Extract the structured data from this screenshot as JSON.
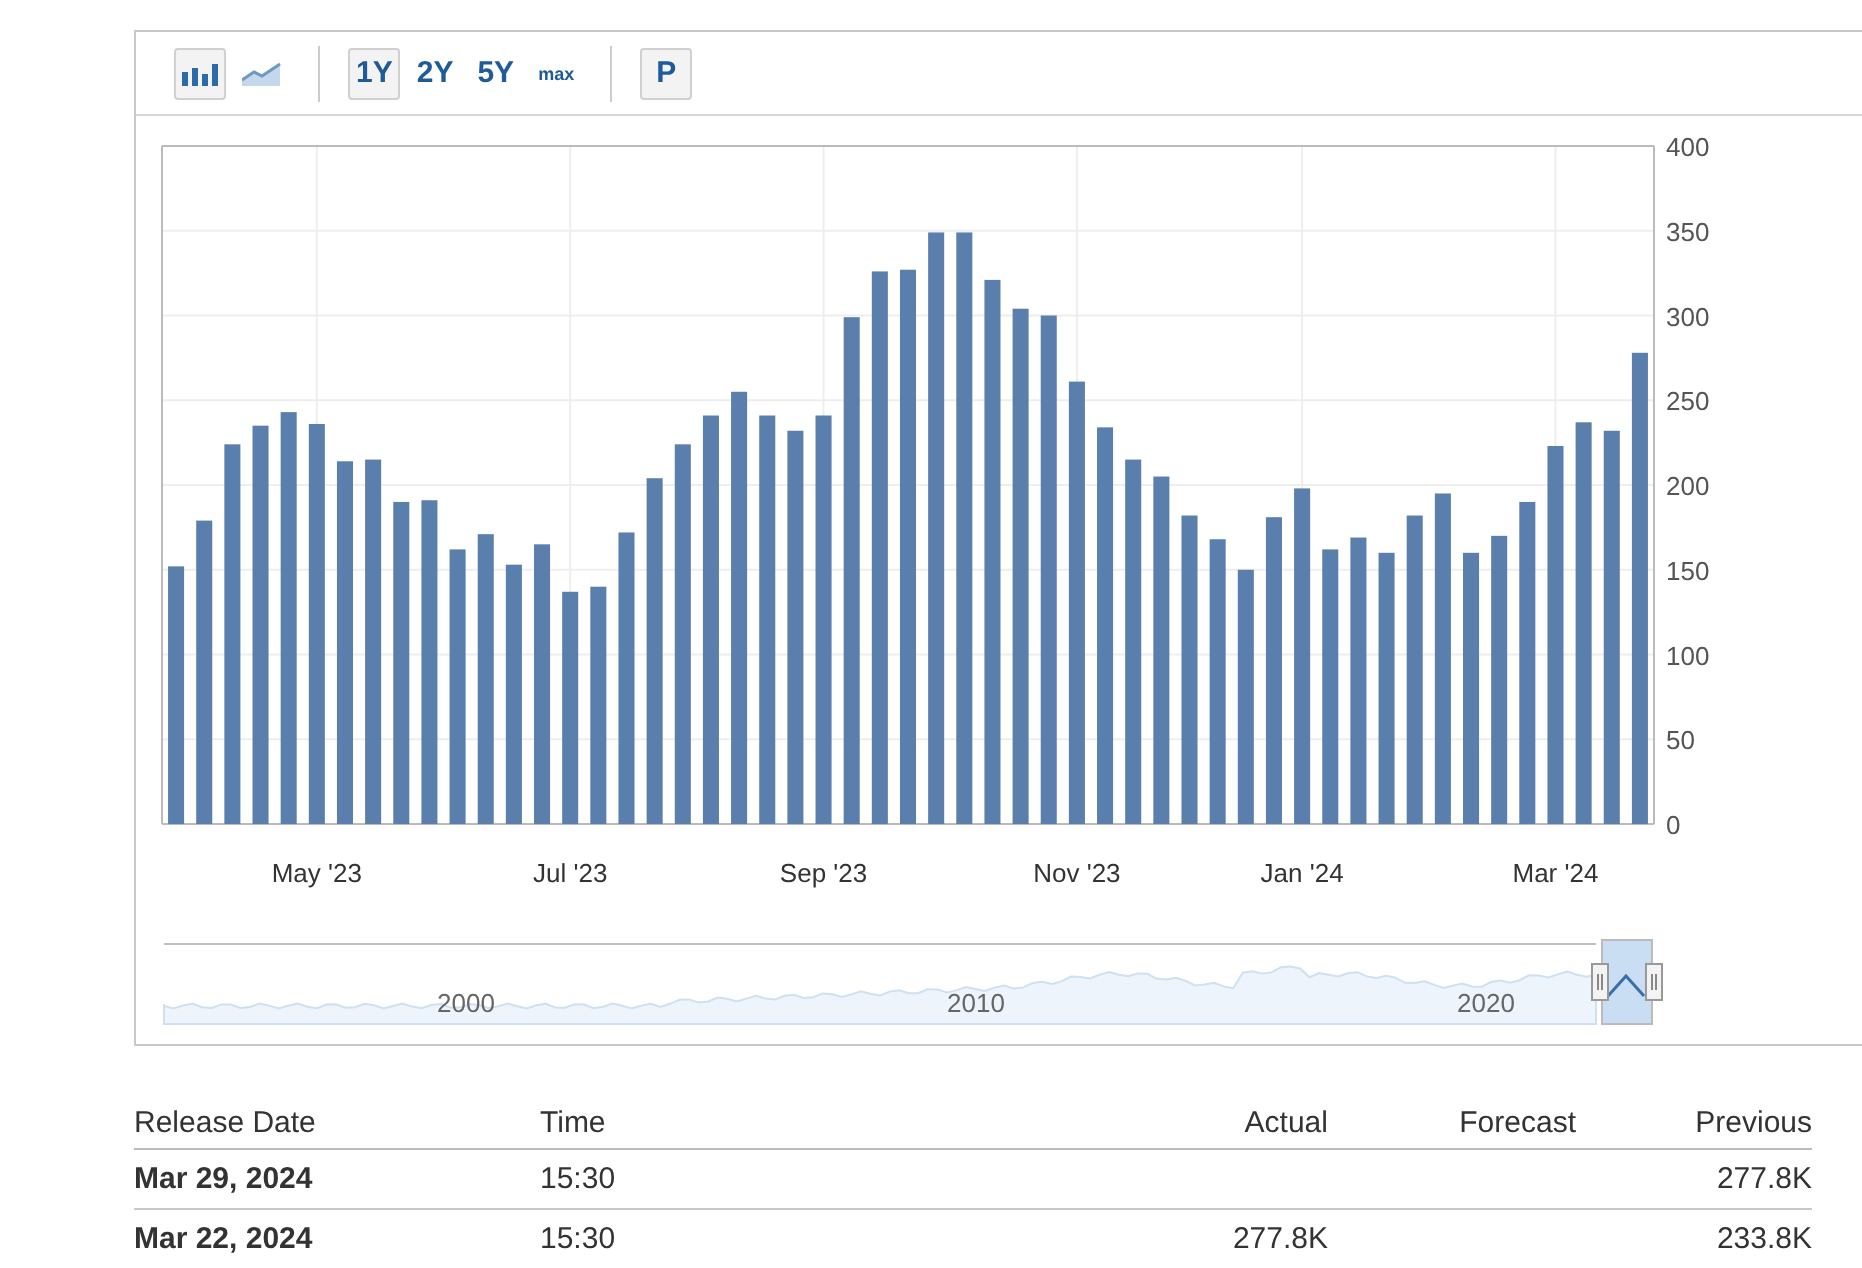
{
  "toolbar": {
    "groups": [
      [
        {
          "kind": "bar_chart",
          "selected": true
        },
        {
          "kind": "line_chart",
          "selected": false
        }
      ],
      [
        {
          "kind": "range",
          "label": "1Y",
          "selected": true
        },
        {
          "kind": "range",
          "label": "2Y",
          "selected": false
        },
        {
          "kind": "range",
          "label": "5Y",
          "selected": false
        },
        {
          "kind": "range_small",
          "label": "max",
          "selected": false
        }
      ],
      [
        {
          "kind": "button",
          "label": "P"
        }
      ]
    ]
  },
  "chart": {
    "chart_data": {
      "type": "bar",
      "categories": [
        null,
        null,
        null,
        null,
        null,
        "May '23",
        null,
        null,
        null,
        null,
        null,
        null,
        null,
        null,
        "Jul '23",
        null,
        null,
        null,
        null,
        null,
        null,
        null,
        null,
        "Sep '23",
        null,
        null,
        null,
        null,
        null,
        null,
        null,
        null,
        "Nov '23",
        null,
        null,
        null,
        null,
        null,
        null,
        null,
        "Jan '24",
        null,
        null,
        null,
        null,
        null,
        null,
        null,
        null,
        "Mar '24",
        null,
        null,
        null
      ],
      "grid": true,
      "series": [
        {
          "color": "#5b7fac",
          "values": [
            152,
            179,
            224,
            235,
            243,
            236,
            214,
            215,
            190,
            191,
            162,
            171,
            153,
            165,
            137,
            140,
            172,
            204,
            224,
            241,
            255,
            241,
            232,
            241,
            299,
            326,
            327,
            349,
            349,
            321,
            304,
            300,
            261,
            234,
            215,
            205,
            182,
            168,
            150,
            181,
            198,
            162,
            169,
            160,
            182,
            195,
            160,
            170,
            190,
            223,
            237,
            232,
            278
          ]
        }
      ],
      "ylim": [
        0,
        400
      ],
      "yticks": [
        0,
        50,
        100,
        150,
        200,
        250,
        300,
        350,
        400
      ]
    },
    "navigator": {
      "labels": [
        "2000",
        "2010",
        "2020"
      ]
    }
  },
  "table": {
    "columns": [
      "Release Date",
      "Time",
      "Actual",
      "Forecast",
      "Previous"
    ],
    "rows": [
      {
        "release_date": "Mar 29, 2024",
        "time": "15:30",
        "previous": "277.8K"
      },
      {
        "release_date": "Mar 22, 2024",
        "time": "15:30",
        "actual": "277.8K",
        "previous": "233.8K"
      }
    ]
  }
}
